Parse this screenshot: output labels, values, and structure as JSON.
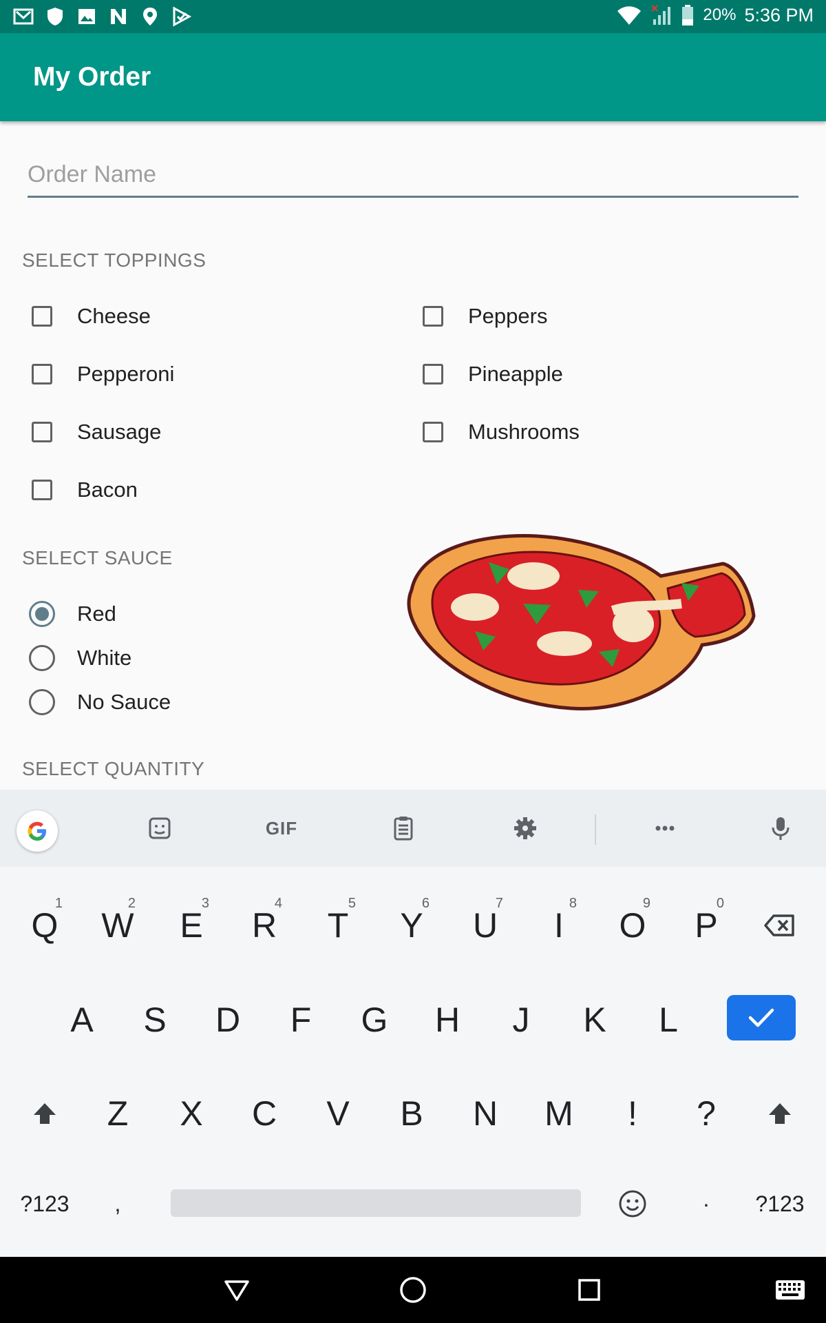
{
  "status_bar": {
    "battery_percent": "20%",
    "time": "5:36 PM",
    "left_icons": [
      "mail-icon",
      "shield-icon",
      "image-icon",
      "n-icon",
      "location-icon",
      "play-check-icon"
    ],
    "right_icons": [
      "wifi-icon",
      "signal-icon",
      "battery-icon"
    ]
  },
  "app_bar": {
    "title": "My Order",
    "color": "#009688"
  },
  "form": {
    "order_name_placeholder": "Order Name",
    "toppings_header": "SELECT TOPPINGS",
    "toppings_left": [
      "Cheese",
      "Pepperoni",
      "Sausage",
      "Bacon"
    ],
    "toppings_right": [
      "Peppers",
      "Pineapple",
      "Mushrooms"
    ],
    "sauce_header": "SELECT SAUCE",
    "sauces": [
      "Red",
      "White",
      "No Sauce"
    ],
    "selected_sauce": "Red",
    "quantity_header": "SELECT QUANTITY"
  },
  "keyboard": {
    "toolbar_gif": "GIF",
    "row1": [
      "Q",
      "W",
      "E",
      "R",
      "T",
      "Y",
      "U",
      "I",
      "O",
      "P"
    ],
    "row1_hints": [
      "1",
      "2",
      "3",
      "4",
      "5",
      "6",
      "7",
      "8",
      "9",
      "0"
    ],
    "row2": [
      "A",
      "S",
      "D",
      "F",
      "G",
      "H",
      "J",
      "K",
      "L"
    ],
    "row3": [
      "Z",
      "X",
      "C",
      "V",
      "B",
      "N",
      "M",
      "!",
      "?"
    ],
    "symbols_key": "?123",
    "comma_key": ",",
    "period_key": "·",
    "enter_color": "#1a73e8"
  }
}
